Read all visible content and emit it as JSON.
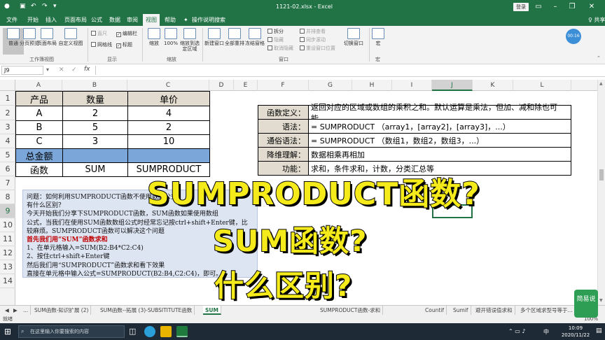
{
  "window": {
    "title": "1121-02.xlsx  -  Excel",
    "login": "登录",
    "share": "♀ 共享",
    "autosave_badge": "00:16"
  },
  "ribbon_tabs": [
    "文件",
    "开始",
    "插入",
    "页面布局",
    "公式",
    "数据",
    "审阅",
    "视图",
    "帮助",
    "操作说明搜索"
  ],
  "active_tab": "视图",
  "ribbon": {
    "buttons": [
      "普通",
      "分页预览",
      "页面布局",
      "自定义视图",
      "缩放",
      "100%",
      "缩放到选定区域",
      "新建窗口",
      "全部重排",
      "冻结窗格",
      "切换窗口",
      "宏"
    ],
    "checks": [
      "直尺",
      "编辑栏",
      "网格线",
      "标题"
    ],
    "win_items": [
      "拆分",
      "隐藏",
      "取消隐藏",
      "并排查看",
      "同步滚动",
      "重设窗口位置"
    ],
    "groups": [
      "工作簿视图",
      "显示",
      "缩放",
      "窗口",
      "宏"
    ]
  },
  "formula_bar": {
    "name_box": "J9",
    "fx": "fx",
    "formula": ""
  },
  "columns": [
    "A",
    "B",
    "C",
    "D",
    "E",
    "F",
    "G",
    "H",
    "I",
    "J",
    "K",
    "L"
  ],
  "rows": [
    "1",
    "2",
    "3",
    "4",
    "5",
    "6",
    "7",
    "8",
    "9",
    "10",
    "11",
    "12",
    "13",
    "14"
  ],
  "selected_column": "J",
  "table": {
    "header": [
      "产品",
      "数量",
      "单价"
    ],
    "rows": [
      [
        "A",
        "2",
        "4"
      ],
      [
        "B",
        "5",
        "2"
      ],
      [
        "C",
        "3",
        "10"
      ]
    ],
    "total_label": "总金额",
    "func_row": [
      "函数",
      "SUM",
      "SUMPRODUCT"
    ]
  },
  "def_table": [
    {
      "label": "函数定义：",
      "value": "返回对应的区域或数组的乘积之和。默认运算是乘法，但加、减和除也可能。"
    },
    {
      "label": "语法：",
      "value": "= SUMPRODUCT （array1，[array2]，[array3]，...）"
    },
    {
      "label": "通俗语法：",
      "value": "= SUMPRODUCT （数组1，数组2，数组3，...）"
    },
    {
      "label": "降维理解：",
      "value": "数据相乘再相加"
    },
    {
      "label": "功能：",
      "value": "求和，条件求和，计数，分类汇总等"
    }
  ],
  "note": {
    "l1": "问题：如何利用SUMPRODUCT函数不使用数组公式",
    "l2": "有什么区别？",
    "l3": "今天开始我们分享下SUMPRODUCT函数，SUM函数如果使用数组",
    "l4": "公式，当我们在使用SUM函数数组公式时经常忘记按ctrl+shift+Enter键，比",
    "l5": "较麻烦。SUMPRODUCT函数可以解决这个问题",
    "l6": "首先我们用“SUM”函数求和",
    "l7": "1、在单元格输入=SUM(B2:B4*C2:C4)",
    "l8": "2、按住ctrl+shift+Enter键",
    "l9": "然后我们用“SUMPRODUCT”函数求和看下效果",
    "l10": "直接在单元格中输入公式=SUMPRODUCT(B2:B4,C2:C4)，即可。"
  },
  "captions": [
    "SUMPRODUCT函数?",
    "SUM函数?",
    "什么区别?"
  ],
  "sheet_tabs": [
    "...",
    "SUM函数-知识扩展 (2)",
    "SUM函数--拓展 (3)-SUBSITITUTE函数",
    "SUM",
    "SUMPRODUCT函数-求和",
    "Countif",
    "Sumif",
    "避开错误值求和",
    "多个区域求型号等于..."
  ],
  "active_sheet": "SUM",
  "status": {
    "ready": "就绪",
    "zoom": "100%"
  },
  "taskbar": {
    "search": "在这里输入你要搜索的内容",
    "time": "10:09",
    "date": "2020/11/22",
    "lang": "中",
    "watermark": "简易说"
  },
  "colors": {
    "accent": "#217346",
    "blue_cell": "#7aa6d9",
    "label_bg": "#e1dccf",
    "note_bg": "#dde5f3",
    "caption": "#f5ea1a"
  }
}
